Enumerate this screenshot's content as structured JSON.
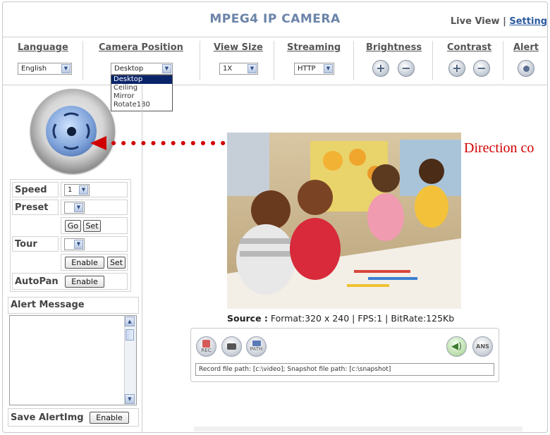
{
  "header": {
    "title": "MPEG4 IP CAMERA",
    "nav_live": "Live View",
    "nav_sep": "|",
    "nav_setting": "Setting"
  },
  "toolbar": {
    "language_label": "Language",
    "language_value": "English",
    "camera_position_label": "Camera Position",
    "camera_position_value": "Desktop",
    "camera_position_options": [
      "Desktop",
      "Ceiling",
      "Mirror",
      "Rotate180"
    ],
    "view_size_label": "View Size",
    "view_size_value": "1X",
    "streaming_label": "Streaming",
    "streaming_value": "HTTP",
    "brightness_label": "Brightness",
    "contrast_label": "Contrast",
    "alert_label": "Alert"
  },
  "controls": {
    "speed_label": "Speed",
    "speed_value": "1",
    "preset_label": "Preset",
    "preset_value": "",
    "go_label": "Go",
    "set_label": "Set",
    "tour_label": "Tour",
    "tour_value": "",
    "enable_label": "Enable",
    "tour_set_label": "Set",
    "autopan_label": "AutoPan",
    "autopan_enable": "Enable"
  },
  "alert": {
    "title": "Alert Message",
    "save_label": "Save AlertImg",
    "save_enable": "Enable"
  },
  "video": {
    "source_label": "Source :",
    "source_info": "Format:320 x 240 | FPS:1 | BitRate:125Kb"
  },
  "recorder": {
    "rec_text": "REC",
    "path_text": "PATH",
    "ans_text": "ANS",
    "file_paths": "Record file path: [c:\\video]; Snapshot file path: [c:\\snapshot]"
  },
  "annotation": {
    "text": "Direction co",
    "color": "#d10000"
  },
  "colors": {
    "title": "#6b84a8",
    "link": "#2c5aa0",
    "highlight": "#0a246a"
  }
}
